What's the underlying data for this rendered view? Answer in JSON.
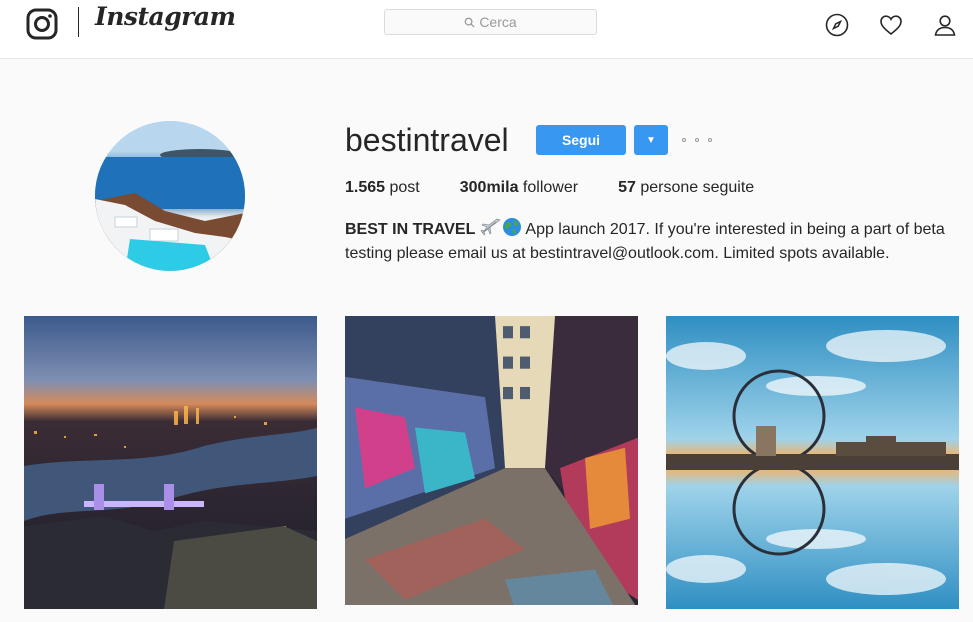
{
  "nav": {
    "app_name": "Instagram",
    "search_placeholder": "Cerca",
    "icons": [
      "instagram-logo-icon",
      "search-icon",
      "compass-icon",
      "heart-icon",
      "profile-icon"
    ]
  },
  "profile": {
    "username": "bestintravel",
    "follow_label": "Segui",
    "dropdown_icon": "▼",
    "stats": [
      {
        "value": "1.565",
        "label": "post"
      },
      {
        "value": "300mila",
        "label": "follower"
      },
      {
        "value": "57",
        "label": "persone seguite"
      }
    ],
    "bio_name": "BEST IN TRAVEL",
    "bio_text": " App launch 2017. If you're interested in being a part of beta testing please email us at bestintravel@outlook.com. Limited spots available."
  },
  "posts": [
    {
      "subject": "london-tower-bridge-night"
    },
    {
      "subject": "graffiti-alley"
    },
    {
      "subject": "london-eye-reflection"
    }
  ],
  "colors": {
    "accent": "#3897f0",
    "text": "#262626",
    "background": "#fafafa"
  }
}
